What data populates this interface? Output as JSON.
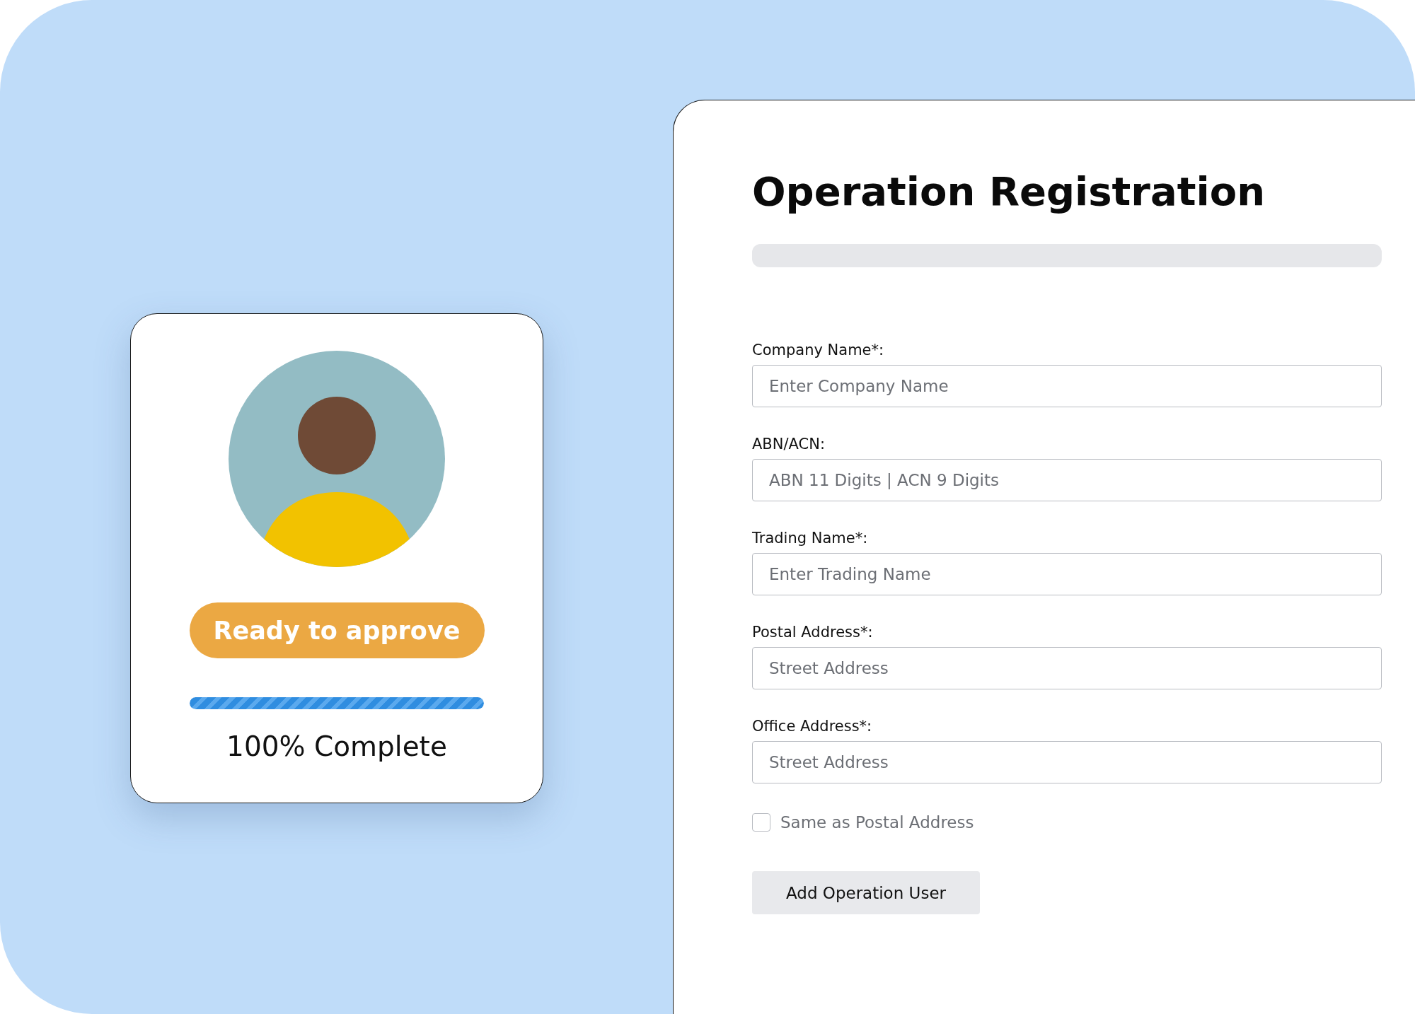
{
  "profile_card": {
    "status_badge": "Ready to approve",
    "progress": {
      "level": 1
    },
    "progress_label": "100% Complete"
  },
  "form": {
    "title": "Operation Registration",
    "form_progress": {
      "level": 0
    },
    "fields": [
      {
        "label": "Company Name*:",
        "placeholder": "Enter Company Name"
      },
      {
        "label": "ABN/ACN:",
        "placeholder": "ABN 11 Digits | ACN 9 Digits"
      },
      {
        "label": "Trading Name*:",
        "placeholder": "Enter Trading Name"
      },
      {
        "label": "Postal Address*:",
        "placeholder": "Street Address"
      },
      {
        "label": "Office Address*:",
        "placeholder": "Street Address"
      }
    ],
    "same_as_postal": {
      "label": "Same as Postal Address",
      "checked": false
    },
    "button": "Add Operation User"
  }
}
